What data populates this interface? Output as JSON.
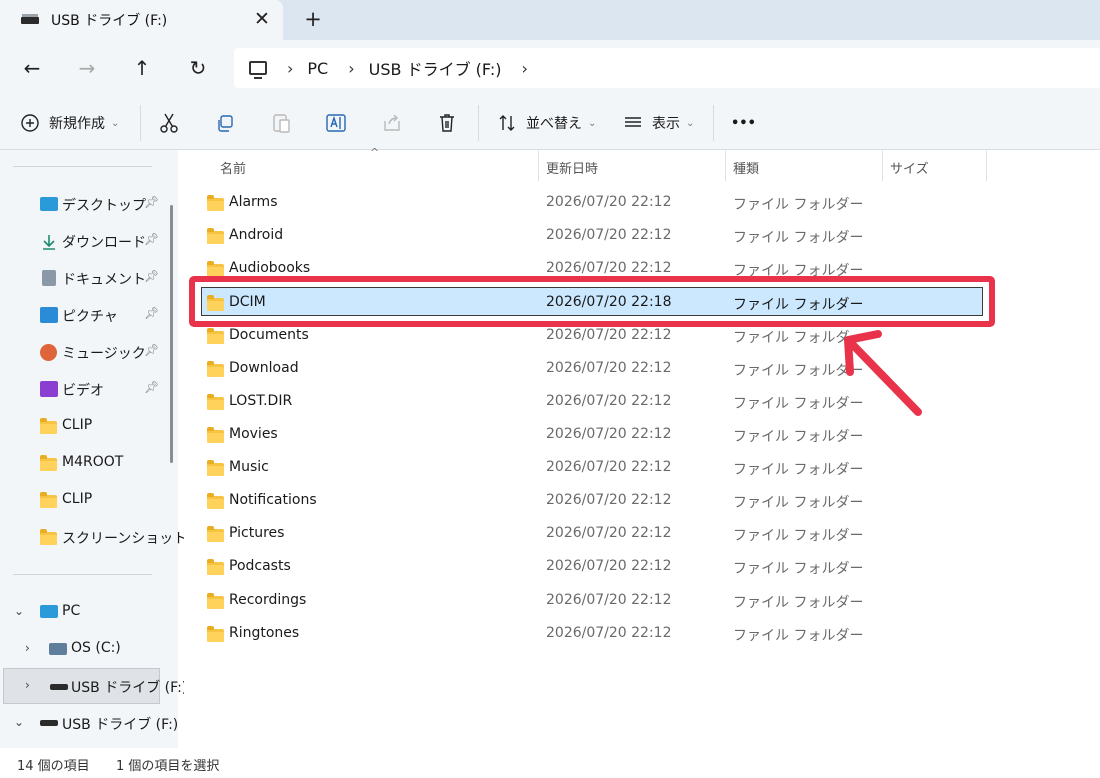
{
  "tab": {
    "title": "USB ドライブ (F:)",
    "close": "✕",
    "new_tab": "+"
  },
  "nav": {
    "back": "←",
    "forward": "→",
    "up": "↑",
    "refresh": "↻"
  },
  "breadcrumb": {
    "sep": "›",
    "items": [
      "PC",
      "USB ドライブ (F:)"
    ]
  },
  "commands": {
    "new": "新規作成",
    "sort": "並べ替え",
    "view": "表示",
    "more": "•••"
  },
  "sidebar": {
    "quick_access": [
      {
        "label": "デスクトップ",
        "icon": "desktop-icon",
        "color": "#2b9ad8"
      },
      {
        "label": "ダウンロード",
        "icon": "download-icon",
        "color": "#1f8a70"
      },
      {
        "label": "ドキュメント",
        "icon": "document-icon",
        "color": "#6b7a8a"
      },
      {
        "label": "ピクチャ",
        "icon": "pictures-icon",
        "color": "#2a8bd6"
      },
      {
        "label": "ミュージック",
        "icon": "music-icon",
        "color": "#e0643a"
      },
      {
        "label": "ビデオ",
        "icon": "video-icon",
        "color": "#8b3fd1"
      },
      {
        "label": "CLIP",
        "icon": "folder-icon"
      },
      {
        "label": "M4ROOT",
        "icon": "folder-icon"
      },
      {
        "label": "CLIP",
        "icon": "folder-icon"
      },
      {
        "label": "スクリーンショット",
        "icon": "folder-icon"
      }
    ],
    "tree": {
      "pc": "PC",
      "os": "OS (C:)",
      "usb_selected": "USB ドライブ (F:)",
      "usb": "USB ドライブ (F:)"
    }
  },
  "columns": {
    "name": "名前",
    "modified": "更新日時",
    "type": "種類",
    "size": "サイズ"
  },
  "files": [
    {
      "name": "Alarms",
      "date": "2026/07/20 22:12",
      "type": "ファイル フォルダー"
    },
    {
      "name": "Android",
      "date": "2026/07/20 22:12",
      "type": "ファイル フォルダー"
    },
    {
      "name": "Audiobooks",
      "date": "2026/07/20 22:12",
      "type": "ファイル フォルダー"
    },
    {
      "name": "DCIM",
      "date": "2026/07/20 22:18",
      "type": "ファイル フォルダー",
      "selected": true
    },
    {
      "name": "Documents",
      "date": "2026/07/20 22:12",
      "type": "ファイル フォルダー"
    },
    {
      "name": "Download",
      "date": "2026/07/20 22:12",
      "type": "ファイル フォルダー"
    },
    {
      "name": "LOST.DIR",
      "date": "2026/07/20 22:12",
      "type": "ファイル フォルダー"
    },
    {
      "name": "Movies",
      "date": "2026/07/20 22:12",
      "type": "ファイル フォルダー"
    },
    {
      "name": "Music",
      "date": "2026/07/20 22:12",
      "type": "ファイル フォルダー"
    },
    {
      "name": "Notifications",
      "date": "2026/07/20 22:12",
      "type": "ファイル フォルダー"
    },
    {
      "name": "Pictures",
      "date": "2026/07/20 22:12",
      "type": "ファイル フォルダー"
    },
    {
      "name": "Podcasts",
      "date": "2026/07/20 22:12",
      "type": "ファイル フォルダー"
    },
    {
      "name": "Recordings",
      "date": "2026/07/20 22:12",
      "type": "ファイル フォルダー"
    },
    {
      "name": "Ringtones",
      "date": "2026/07/20 22:12",
      "type": "ファイル フォルダー"
    }
  ],
  "status": {
    "count": "14 個の項目",
    "selection": "1 個の項目を選択"
  },
  "colors": {
    "accent_selection": "#cce8ff",
    "annotation": "#e8334a",
    "chrome": "#f3f6f9"
  }
}
